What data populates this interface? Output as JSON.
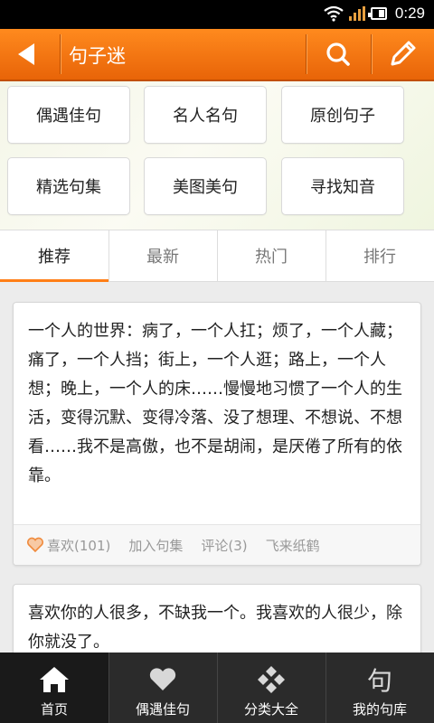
{
  "status_bar": {
    "time": "0:29"
  },
  "header": {
    "title": "句子迷"
  },
  "categories": [
    {
      "label": "偶遇佳句"
    },
    {
      "label": "名人名句"
    },
    {
      "label": "原创句子"
    },
    {
      "label": "精选句集"
    },
    {
      "label": "美图美句"
    },
    {
      "label": "寻找知音"
    }
  ],
  "tabs": [
    {
      "label": "推荐",
      "active": true
    },
    {
      "label": "最新"
    },
    {
      "label": "热门"
    },
    {
      "label": "排行"
    }
  ],
  "feed": [
    {
      "text": "一个人的世界：病了，一个人扛；烦了，一个人藏；痛了，一个人挡；街上，一个人逛；路上，一个人想；晚上，一个人的床……慢慢地习惯了一个人的生活，变得沉默、变得冷落、没了想理、不想说、不想看……我不是高傲，也不是胡闹，是厌倦了所有的依靠。",
      "like_label": "喜欢(101)",
      "collect_label": "加入句集",
      "comment_label": "评论(3)",
      "share_label": "飞来纸鹤"
    },
    {
      "text": "喜欢你的人很多，不缺我一个。我喜欢的人很少，除你就没了。"
    }
  ],
  "bottom_nav": [
    {
      "label": "首页",
      "icon": "home-icon",
      "active": true
    },
    {
      "label": "偶遇佳句",
      "icon": "heart-icon"
    },
    {
      "label": "分类大全",
      "icon": "diamonds-icon"
    },
    {
      "label": "我的句库",
      "icon": "ju-character-icon",
      "glyph": "句"
    }
  ],
  "colors": {
    "accent": "#ff7e16",
    "header": "#e86408",
    "nav_bg": "#2b2b2b"
  }
}
